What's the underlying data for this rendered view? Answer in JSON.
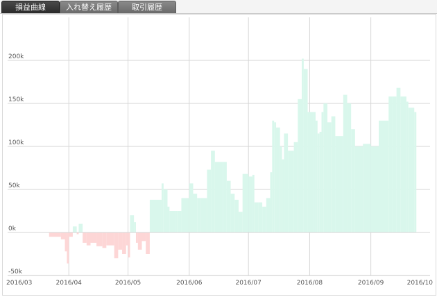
{
  "tabs": [
    {
      "label": "損益曲線",
      "active": true
    },
    {
      "label": "入れ替え履歴",
      "active": false
    },
    {
      "label": "取引履歴",
      "active": false
    }
  ],
  "chart_data": {
    "type": "area",
    "title": "",
    "xlabel": "",
    "ylabel": "",
    "x_ticks": [
      "2016/03",
      "2016/04",
      "2016/05",
      "2016/06",
      "2016/07",
      "2016/08",
      "2016/09",
      "2016/10"
    ],
    "y_ticks": [
      "-50k",
      "0k",
      "50k",
      "100k",
      "150k",
      "200k"
    ],
    "xlim": [
      "2016-03-01",
      "2016-10-01"
    ],
    "ylim": [
      -50000,
      250000
    ],
    "grid": true,
    "positive_color": "#d9f7ec",
    "negative_color": "#fdd6d6",
    "series": [
      {
        "x": [
          "2016-03-22",
          "2016-03-28",
          "2016-03-30",
          "2016-03-31",
          "2016-04-01",
          "2016-04-03",
          "2016-04-05",
          "2016-04-06",
          "2016-04-08",
          "2016-04-10",
          "2016-04-12",
          "2016-04-15",
          "2016-04-18",
          "2016-04-20",
          "2016-04-24",
          "2016-04-26",
          "2016-04-28",
          "2016-04-30",
          "2016-05-01",
          "2016-05-02",
          "2016-05-04",
          "2016-05-05",
          "2016-05-06",
          "2016-05-08",
          "2016-05-10",
          "2016-05-12",
          "2016-05-18",
          "2016-05-19",
          "2016-05-21",
          "2016-05-22",
          "2016-05-25",
          "2016-05-26",
          "2016-05-28",
          "2016-06-01",
          "2016-06-03",
          "2016-06-05",
          "2016-06-07",
          "2016-06-10",
          "2016-06-12",
          "2016-06-14",
          "2016-06-18",
          "2016-06-20",
          "2016-06-22",
          "2016-06-24",
          "2016-06-26",
          "2016-06-28",
          "2016-07-01",
          "2016-07-03",
          "2016-07-04",
          "2016-07-06",
          "2016-07-08",
          "2016-07-10",
          "2016-07-12",
          "2016-07-13",
          "2016-07-14",
          "2016-07-15",
          "2016-07-17",
          "2016-07-18",
          "2016-07-19",
          "2016-07-21",
          "2016-07-24",
          "2016-07-26",
          "2016-07-28",
          "2016-07-29",
          "2016-07-31",
          "2016-08-03",
          "2016-08-04",
          "2016-08-05",
          "2016-08-06",
          "2016-08-07",
          "2016-08-08",
          "2016-08-10",
          "2016-08-12",
          "2016-08-14",
          "2016-08-18",
          "2016-08-20",
          "2016-08-22",
          "2016-08-24",
          "2016-08-26",
          "2016-08-28",
          "2016-09-01",
          "2016-09-05",
          "2016-09-10",
          "2016-09-12",
          "2016-09-14",
          "2016-09-16",
          "2016-09-18",
          "2016-09-19",
          "2016-09-20",
          "2016-09-23"
        ],
        "y": [
          -5000,
          -8000,
          -22000,
          -36000,
          -5000,
          7000,
          -2000,
          10000,
          -12000,
          -15000,
          -12000,
          -16000,
          -18000,
          -15000,
          -30000,
          -20000,
          -25000,
          -15000,
          -29000,
          20000,
          12000,
          -12000,
          -20000,
          -10000,
          -25000,
          38000,
          57000,
          50000,
          30000,
          25000,
          25000,
          25000,
          40000,
          57000,
          45000,
          40000,
          40000,
          73000,
          95000,
          82000,
          82000,
          60000,
          45000,
          38000,
          24000,
          68000,
          65000,
          67000,
          35000,
          35000,
          30000,
          40000,
          70000,
          130000,
          128000,
          122000,
          100000,
          85000,
          115000,
          95000,
          105000,
          155000,
          202000,
          190000,
          140000,
          140000,
          130000,
          115000,
          117000,
          140000,
          150000,
          128000,
          135000,
          112000,
          160000,
          150000,
          120000,
          100000,
          100000,
          103000,
          100000,
          130000,
          158000,
          158000,
          168000,
          158000,
          158000,
          152000,
          145000,
          140000
        ]
      }
    ]
  }
}
